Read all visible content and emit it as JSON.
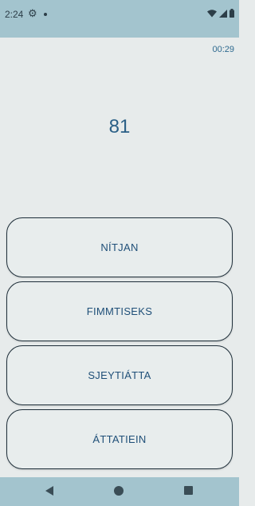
{
  "status_bar": {
    "time": "2:24",
    "icons": [
      "settings-icon",
      "notification-dot-icon",
      "wifi-icon",
      "signal-icon",
      "battery-icon"
    ]
  },
  "game": {
    "timer": "00:29",
    "number": "81",
    "answers": [
      "NÍTJAN",
      "FIMMTISEKS",
      "SJEYTIÁTTA",
      "ÁTTATIEIN"
    ]
  },
  "nav_bar": {
    "icons": [
      "back-icon",
      "home-icon",
      "recents-icon"
    ]
  },
  "colors": {
    "bars": "#a3c4ce",
    "background": "#e7ebeb",
    "text_accent": "#2a5f86"
  }
}
